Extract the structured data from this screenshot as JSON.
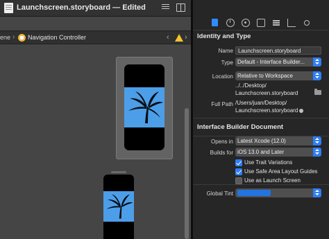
{
  "window": {
    "title": "Launchscreen.storyboard — Edited"
  },
  "jumpbar": {
    "scene": "ene",
    "item": "Navigation Controller"
  },
  "inspector": {
    "identity": {
      "heading": "Identity and Type",
      "name_label": "Name",
      "name_value": "Launchscreen.storyboard",
      "type_label": "Type",
      "type_value": "Default - Interface Builder...",
      "location_label": "Location",
      "location_value": "Relative to Workspace",
      "path_line1": "../../Desktop/",
      "path_line2": "Launchscreen.storyboard",
      "fullpath_label": "Full Path",
      "fullpath_line1": "/Users/juan/Desktop/",
      "fullpath_line2": "Launchscreen.storyboard"
    },
    "ib": {
      "heading": "Interface Builder Document",
      "opens_label": "Opens in",
      "opens_value": "Latest Xcode (12.0)",
      "builds_label": "Builds for",
      "builds_value": "iOS 13.0 and Later",
      "trait_label": "Use Trait Variations",
      "trait_checked": true,
      "safe_label": "Use Safe Area Layout Guides",
      "safe_checked": true,
      "launch_label": "Use as Launch Screen",
      "launch_checked": false,
      "tint_label": "Global Tint",
      "tint_color": "#2374e0"
    }
  },
  "colors": {
    "accent": "#2f7ff5",
    "hero_bg": "#4d9ee8",
    "warning": "#f2c230"
  }
}
